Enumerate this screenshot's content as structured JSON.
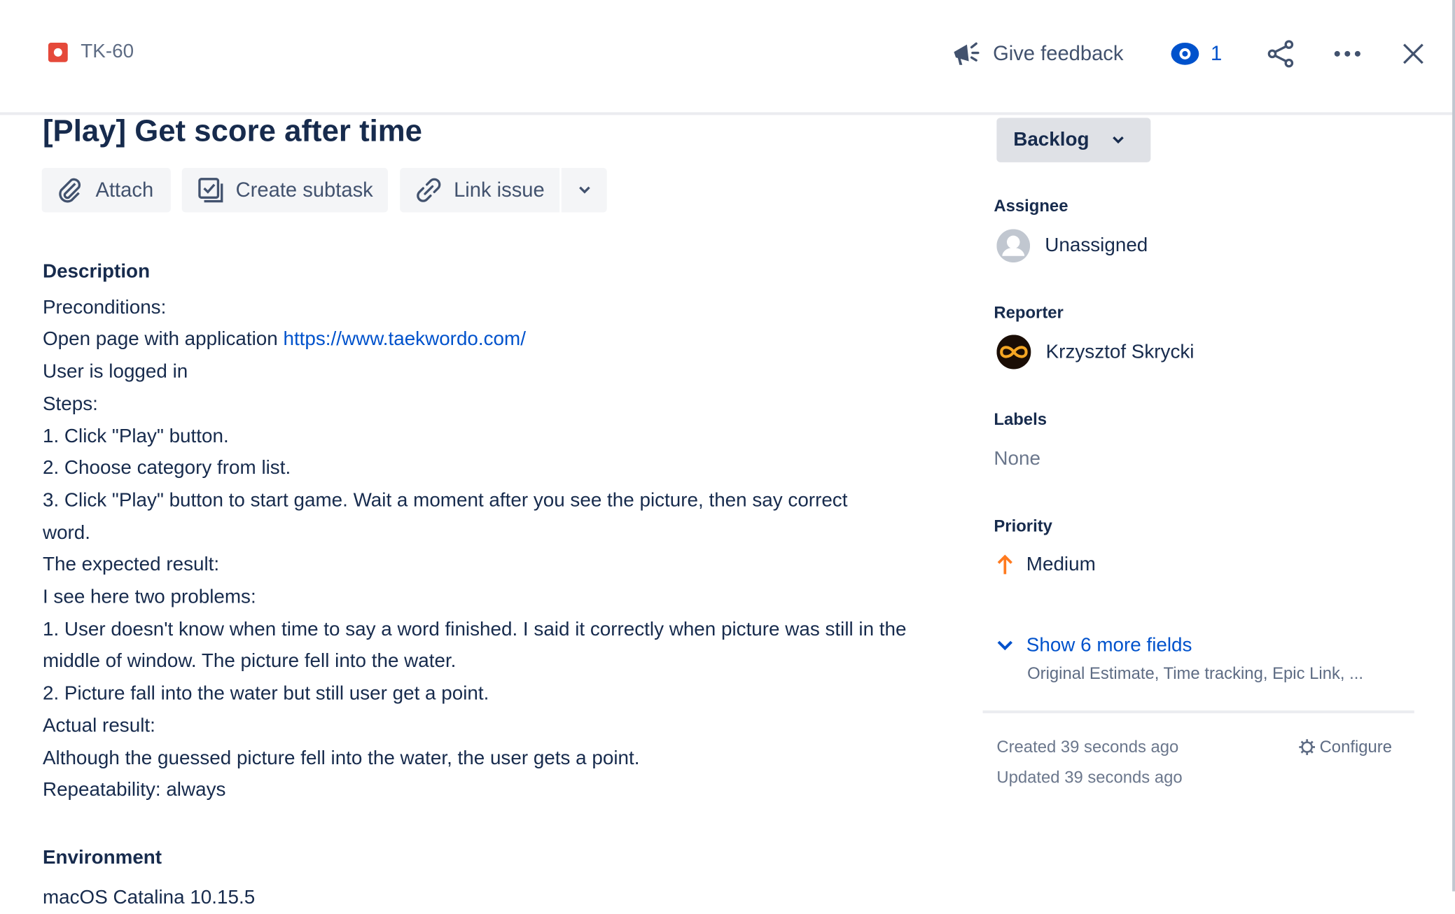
{
  "header": {
    "issue_key": "TK-60",
    "feedback_label": "Give feedback",
    "watchers_count": "1",
    "icons": [
      "bug-icon",
      "megaphone-icon",
      "eye-icon",
      "share-icon",
      "more-icon",
      "close-icon"
    ]
  },
  "issue": {
    "title": "[Play] Get score after time",
    "actions": {
      "attach": "Attach",
      "create_subtask": "Create subtask",
      "link_issue": "Link issue"
    },
    "description_heading": "Description",
    "description": {
      "l1": "Preconditions:",
      "l2_prefix": "Open page with application ",
      "l2_link": "https://www.taekwordo.com/",
      "l3": "User is logged in",
      "l4": "Steps:",
      "l5": "1. Click \"Play\" button.",
      "l6": "2. Choose category from list.",
      "l7": "3. Click \"Play\" button to start game. Wait a moment after you see the picture, then say correct word.",
      "l8": "The expected result:",
      "l9": "I see here two problems:",
      "l10": "1. User doesn't know when time to say a word finished. I said it correctly when picture was still in the middle of window. The picture fell into the water.",
      "l11": "2. Picture fall into the water but still user get a point.",
      "l12": "Actual result:",
      "l13": "Although the guessed picture fell into the water, the user gets a point.",
      "l14": "Repeatability: always"
    },
    "environment_heading": "Environment",
    "environment": "macOS Catalina 10.15.5"
  },
  "sidebar": {
    "status": "Backlog",
    "assignee_label": "Assignee",
    "assignee": "Unassigned",
    "reporter_label": "Reporter",
    "reporter": "Krzysztof Skrycki",
    "labels_label": "Labels",
    "labels": "None",
    "priority_label": "Priority",
    "priority": "Medium",
    "priority_color": "#ff7a1f",
    "more_fields": "Show 6 more fields",
    "more_fields_hint": "Original Estimate, Time tracking, Epic Link, ...",
    "created": "Created 39 seconds ago",
    "updated": "Updated 39 seconds ago",
    "configure": "Configure"
  }
}
